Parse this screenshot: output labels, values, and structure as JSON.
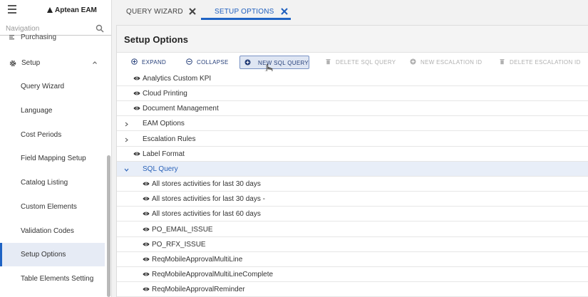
{
  "app": {
    "brand": "Aptean EAM"
  },
  "nav": {
    "search_placeholder": "Navigation",
    "partial_item": "Purchasing",
    "group": {
      "label": "Setup",
      "expanded": true
    },
    "items": [
      {
        "label": "Query Wizard"
      },
      {
        "label": "Language"
      },
      {
        "label": "Cost Periods"
      },
      {
        "label": "Field Mapping Setup"
      },
      {
        "label": "Catalog Listing"
      },
      {
        "label": "Custom Elements"
      },
      {
        "label": "Validation Codes"
      },
      {
        "label": "Setup Options",
        "active": true
      },
      {
        "label": "Table Elements Setting"
      }
    ]
  },
  "tabs": [
    {
      "label": "QUERY WIZARD",
      "active": false
    },
    {
      "label": "SETUP OPTIONS",
      "active": true
    }
  ],
  "panel": {
    "title": "Setup Options"
  },
  "toolbar": {
    "expand": "EXPAND",
    "collapse": "COLLAPSE",
    "new_sql_query": "NEW SQL QUERY",
    "delete_sql_query": "DELETE SQL QUERY",
    "new_escalation_id": "NEW ESCALATION ID",
    "delete_escalation_id": "DELETE ESCALATION ID"
  },
  "tree": [
    {
      "label": "Analytics Custom KPI",
      "kind": "leaf",
      "level": 0
    },
    {
      "label": "Cloud Printing",
      "kind": "leaf",
      "level": 0
    },
    {
      "label": "Document Management",
      "kind": "leaf",
      "level": 0
    },
    {
      "label": "EAM Options",
      "kind": "collapsed",
      "level": 0
    },
    {
      "label": "Escalation Rules",
      "kind": "collapsed",
      "level": 0
    },
    {
      "label": "Label Format",
      "kind": "leaf",
      "level": 0
    },
    {
      "label": "SQL Query",
      "kind": "expanded",
      "level": 0,
      "selected": true
    },
    {
      "label": "All stores activities for last 30 days",
      "kind": "leaf",
      "level": 1
    },
    {
      "label": "All stores activities for last 30 days -",
      "kind": "leaf",
      "level": 1
    },
    {
      "label": "All stores activities for last 60 days",
      "kind": "leaf",
      "level": 1
    },
    {
      "label": "PO_EMAIL_ISSUE",
      "kind": "leaf",
      "level": 1
    },
    {
      "label": "PO_RFX_ISSUE",
      "kind": "leaf",
      "level": 1
    },
    {
      "label": "ReqMobileApprovalMultiLine",
      "kind": "leaf",
      "level": 1
    },
    {
      "label": "ReqMobileApprovalMultiLineComplete",
      "kind": "leaf",
      "level": 1
    },
    {
      "label": "ReqMobileApprovalReminder",
      "kind": "leaf",
      "level": 1
    }
  ],
  "colors": {
    "accent": "#1f63c4",
    "toolbar_text": "#27407a",
    "disabled_text": "#b0b0b0",
    "selected_row_bg": "#e8eef8",
    "selected_nav_bg": "#e6ebf5"
  }
}
